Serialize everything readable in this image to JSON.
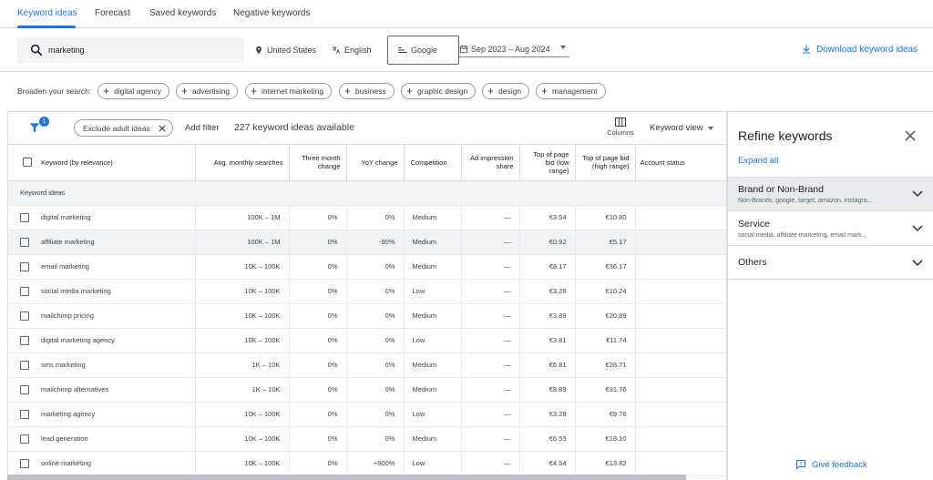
{
  "tabs": [
    "Keyword ideas",
    "Forecast",
    "Saved keywords",
    "Negative keywords"
  ],
  "search": {
    "value": "marketing"
  },
  "location": "United States",
  "language": "English",
  "network": "Google",
  "date_range": "Sep 2023 – Aug 2024",
  "download_label": "Download keyword ideas",
  "broaden": {
    "label": "Broaden your search:",
    "chips": [
      "digital agency",
      "advertising",
      "internet marketing",
      "business",
      "graphic design",
      "design",
      "management"
    ]
  },
  "toolbar": {
    "filter_badge": "1",
    "exclude_chip": "Exclude adult ideas",
    "add_filter": "Add filter",
    "ideas_count": "227 keyword ideas available",
    "columns": "Columns",
    "keyword_view": "Keyword view"
  },
  "table": {
    "headers": {
      "keyword": "Keyword (by relevance)",
      "avg": "Avg. monthly searches",
      "three_month": "Three month change",
      "yoy": "YoY change",
      "competition": "Competition",
      "ad_share": "Ad impression share",
      "bid_low": "Top of page bid (low range)",
      "bid_high": "Top of page bid (high range)",
      "status": "Account status"
    },
    "group_label": "Keyword ideas",
    "rows": [
      {
        "keyword": "digital marketing",
        "avg": "100K – 1M",
        "three": "0%",
        "yoy": "0%",
        "comp": "Medium",
        "share": "—",
        "low": "€3.54",
        "high": "€10.80"
      },
      {
        "keyword": "affiliate marketing",
        "avg": "100K – 1M",
        "three": "0%",
        "yoy": "-90%",
        "comp": "Medium",
        "share": "—",
        "low": "€0.92",
        "high": "€5.17"
      },
      {
        "keyword": "email marketing",
        "avg": "10K – 100K",
        "three": "0%",
        "yoy": "0%",
        "comp": "Medium",
        "share": "—",
        "low": "€8.17",
        "high": "€36.17"
      },
      {
        "keyword": "social media marketing",
        "avg": "10K – 100K",
        "three": "0%",
        "yoy": "0%",
        "comp": "Low",
        "share": "—",
        "low": "€3.28",
        "high": "€10.24"
      },
      {
        "keyword": "mailchimp pricing",
        "avg": "10K – 100K",
        "three": "0%",
        "yoy": "0%",
        "comp": "Medium",
        "share": "—",
        "low": "€3.89",
        "high": "€20.89"
      },
      {
        "keyword": "digital marketing agency",
        "avg": "10K – 100K",
        "three": "0%",
        "yoy": "0%",
        "comp": "Low",
        "share": "—",
        "low": "€3.81",
        "high": "€11.74"
      },
      {
        "keyword": "sms marketing",
        "avg": "1K – 10K",
        "three": "0%",
        "yoy": "0%",
        "comp": "Medium",
        "share": "—",
        "low": "€6.81",
        "high": "€28.71"
      },
      {
        "keyword": "mailchimp alternatives",
        "avg": "1K – 10K",
        "three": "0%",
        "yoy": "0%",
        "comp": "Medium",
        "share": "—",
        "low": "€8.89",
        "high": "€31.76"
      },
      {
        "keyword": "marketing agency",
        "avg": "10K – 100K",
        "three": "0%",
        "yoy": "0%",
        "comp": "Low",
        "share": "—",
        "low": "€3.28",
        "high": "€9.76"
      },
      {
        "keyword": "lead generation",
        "avg": "10K – 100K",
        "three": "0%",
        "yoy": "0%",
        "comp": "Medium",
        "share": "—",
        "low": "€6.53",
        "high": "€18.10"
      },
      {
        "keyword": "online marketing",
        "avg": "10K – 100K",
        "three": "0%",
        "yoy": "+900%",
        "comp": "Low",
        "share": "—",
        "low": "€4.54",
        "high": "€13.82"
      }
    ]
  },
  "refine": {
    "title": "Refine keywords",
    "expand_all": "Expand all",
    "sections": [
      {
        "title": "Brand or Non-Brand",
        "sub": "Non-Brands, google, target, amazon, instagra..."
      },
      {
        "title": "Service",
        "sub": "social media, affiliate marketing, email mark..."
      },
      {
        "title": "Others",
        "sub": ""
      }
    ],
    "feedback": "Give feedback"
  }
}
